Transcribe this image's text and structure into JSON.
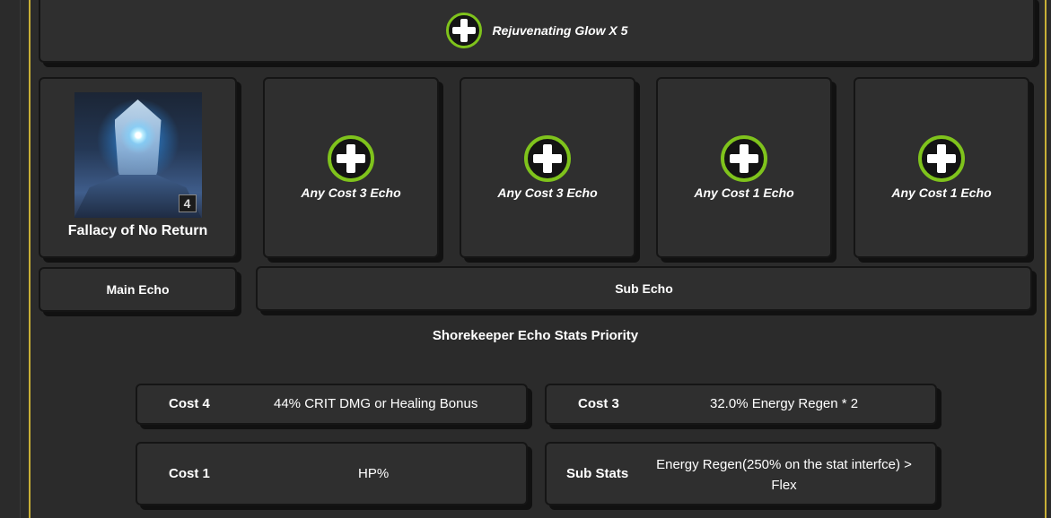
{
  "set_bonus": {
    "label": "Rejuvenating Glow X 5",
    "icon": "plus-circle-icon"
  },
  "main_echo_slot": {
    "name": "Fallacy of No Return",
    "cost_badge": "4"
  },
  "echo_slots": [
    {
      "label": "Any Cost 3 Echo",
      "icon": "plus-circle-icon"
    },
    {
      "label": "Any Cost 3 Echo",
      "icon": "plus-circle-icon"
    },
    {
      "label": "Any Cost 1 Echo",
      "icon": "plus-circle-icon"
    },
    {
      "label": "Any Cost 1 Echo",
      "icon": "plus-circle-icon"
    }
  ],
  "tabs": {
    "main": "Main Echo",
    "sub": "Sub Echo"
  },
  "priority_title": "Shorekeeper Echo Stats Priority",
  "stats": {
    "cost4": {
      "label": "Cost 4",
      "value": "44% CRIT DMG or Healing Bonus"
    },
    "cost3": {
      "label": "Cost 3",
      "value": "32.0% Energy Regen * 2"
    },
    "cost1": {
      "label": "Cost 1",
      "value": "HP%"
    },
    "sub": {
      "label": "Sub Stats",
      "value_line1": "Energy Regen(250% on the stat interfce) >",
      "value_line2": "Flex"
    }
  },
  "colors": {
    "accent_green": "#7fc31c",
    "border_gold": "#c9b037",
    "panel": "#2f2f2f",
    "background": "#2b2b2b"
  }
}
